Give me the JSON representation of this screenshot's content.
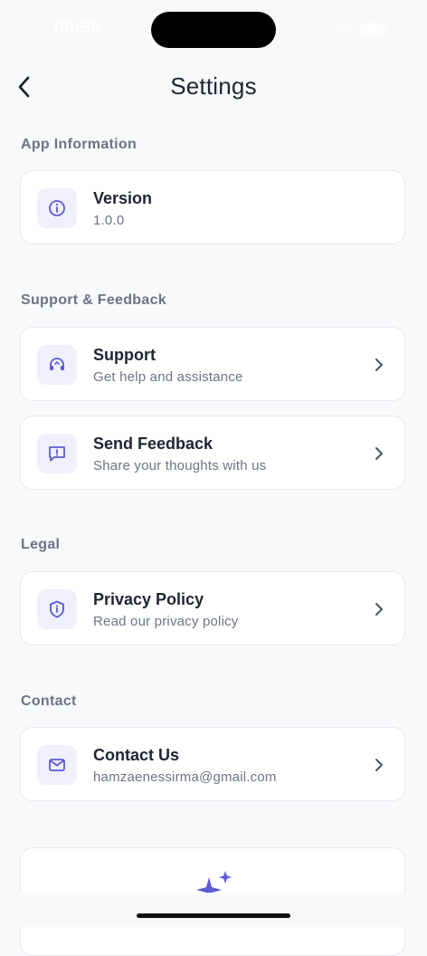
{
  "status_bar": {
    "time": "06:59"
  },
  "header": {
    "title": "Settings"
  },
  "sections": [
    {
      "label": "App Information",
      "items": [
        {
          "title": "Version",
          "subtitle": "1.0.0",
          "icon": "info-icon",
          "has_chevron": false
        }
      ]
    },
    {
      "label": "Support & Feedback",
      "items": [
        {
          "title": "Support",
          "subtitle": "Get help and assistance",
          "icon": "headset-icon",
          "has_chevron": true
        },
        {
          "title": "Send Feedback",
          "subtitle": "Share your thoughts with us",
          "icon": "feedback-icon",
          "has_chevron": true
        }
      ]
    },
    {
      "label": "Legal",
      "items": [
        {
          "title": "Privacy Policy",
          "subtitle": "Read our privacy policy",
          "icon": "shield-icon",
          "has_chevron": true
        }
      ]
    },
    {
      "label": "Contact",
      "items": [
        {
          "title": "Contact Us",
          "subtitle": "hamzaenessirma@gmail.com",
          "icon": "mail-icon",
          "has_chevron": true
        }
      ]
    }
  ],
  "bottom_card": {
    "icon": "sparkle-icon"
  },
  "colors": {
    "accent": "#5b5bd6",
    "icon_bg": "#f0effc",
    "background": "#f8f9fb",
    "text_primary": "#1f2433",
    "text_secondary": "#6b7486"
  }
}
